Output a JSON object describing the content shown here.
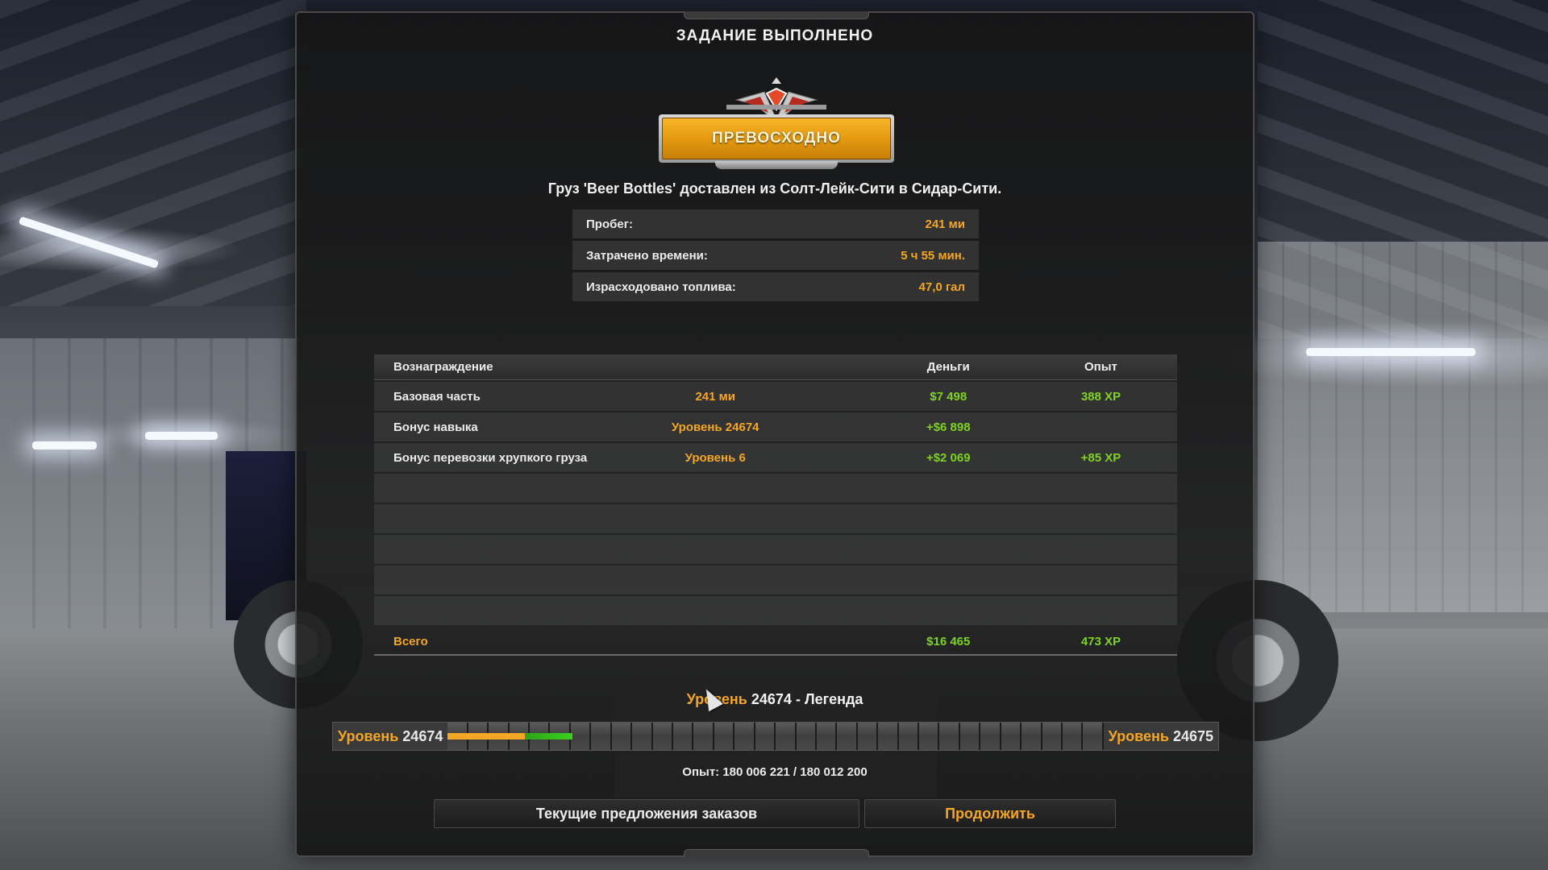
{
  "dialog": {
    "title": "ЗАДАНИЕ ВЫПОЛНЕНО",
    "rating_label": "ПРЕВОСХОДНО",
    "delivery_message": "Груз 'Beer Bottles' доставлен из Солт-Лейк-Сити в Сидар-Сити."
  },
  "stats": [
    {
      "label": "Пробег:",
      "value": "241 ми"
    },
    {
      "label": "Затрачено времени:",
      "value": "5 ч 55 мин."
    },
    {
      "label": "Израсходовано топлива:",
      "value": "47,0 гал"
    }
  ],
  "rewards": {
    "headers": {
      "name": "Вознаграждение",
      "money": "Деньги",
      "xp": "Опыт"
    },
    "rows": [
      {
        "name": "Базовая часть",
        "detail": "241 ми",
        "money": "$7 498",
        "xp": "388 XP"
      },
      {
        "name": "Бонус навыка",
        "detail": "Уровень 24674",
        "money": "+$6 898",
        "xp": ""
      },
      {
        "name": "Бонус перевозки хрупкого груза",
        "detail": "Уровень 6",
        "money": "+$2 069",
        "xp": "+85 XP"
      }
    ],
    "total": {
      "name": "Всего",
      "money": "$16 465",
      "xp": "473 XP"
    }
  },
  "level": {
    "title_prefix": "Уровень",
    "title_rest": "24674 - Легенда",
    "current_prefix": "Уровень",
    "current_number": "24674",
    "next_prefix": "Уровень",
    "next_number": "24675",
    "progress_fraction": 0.19,
    "xp_text": "Опыт: 180 006 221 / 180 012 200"
  },
  "buttons": {
    "offers": "Текущие предложения заказов",
    "continue": "Продолжить"
  },
  "colors": {
    "accent_orange": "#f5a623",
    "reward_green": "#7ed321"
  }
}
